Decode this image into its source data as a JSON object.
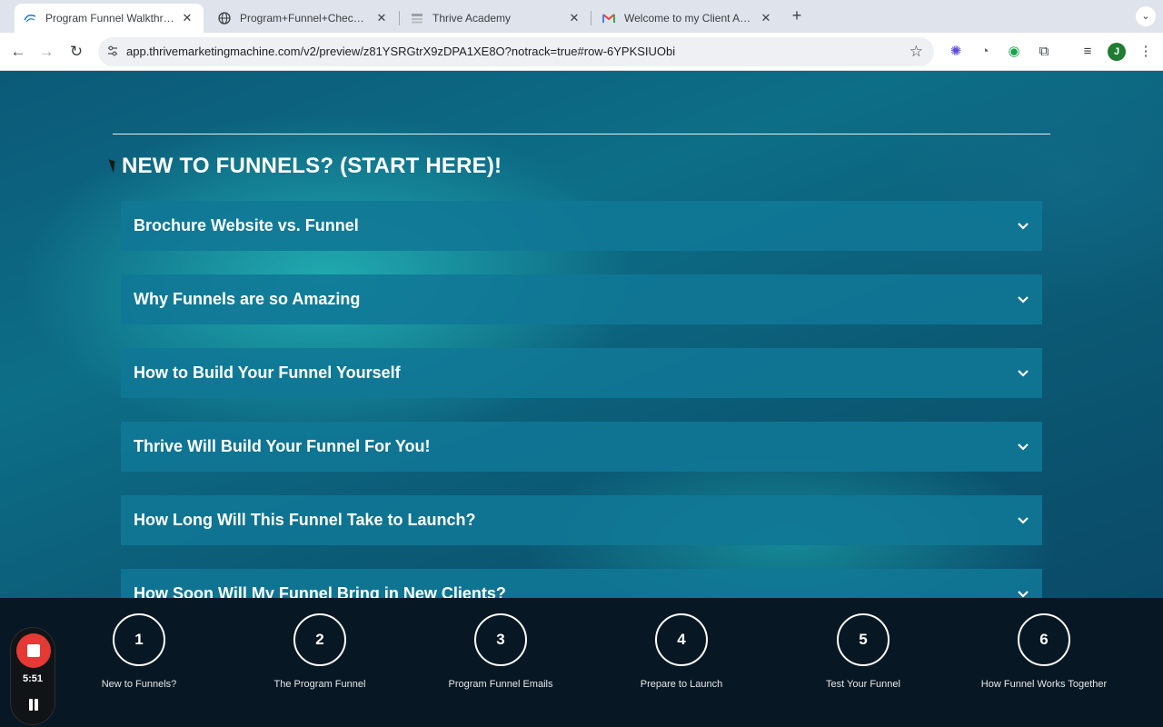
{
  "browser": {
    "tabs": [
      {
        "title": "Program Funnel Walkthrough",
        "active": true,
        "icon": "thrive-logo-icon"
      },
      {
        "title": "Program+Funnel+Checklist.p",
        "active": false,
        "icon": "globe-icon"
      },
      {
        "title": "Thrive Academy",
        "active": false,
        "icon": "thrive-academy-icon"
      },
      {
        "title": "Welcome to my Client Attracti",
        "active": false,
        "icon": "gmail-icon"
      }
    ],
    "url": "app.thrivemarketingmachine.com/v2/preview/z81YSRGtrX9zDPA1XE8O?notrack=true#row-6YPKSIUObi",
    "profile_initial": "J"
  },
  "page": {
    "section_title": "NEW TO FUNNELS? (START HERE)!",
    "accordion": [
      {
        "label": "Brochure Website vs. Funnel"
      },
      {
        "label": "Why Funnels are so Amazing"
      },
      {
        "label": "How to Build Your Funnel Yourself"
      },
      {
        "label": "Thrive Will Build Your Funnel For You!"
      },
      {
        "label": "How Long Will This Funnel Take to Launch?"
      },
      {
        "label": "How Soon Will My Funnel Bring in New Clients?"
      }
    ]
  },
  "steps": [
    {
      "number": "1",
      "label": "New to Funnels?"
    },
    {
      "number": "2",
      "label": "The Program Funnel"
    },
    {
      "number": "3",
      "label": "Program Funnel Emails"
    },
    {
      "number": "4",
      "label": "Prepare to Launch"
    },
    {
      "number": "5",
      "label": "Test Your Funnel"
    },
    {
      "number": "6",
      "label": "How Funnel Works Together"
    }
  ],
  "recorder": {
    "time": "5:51"
  },
  "colors": {
    "accent": "#1078a0",
    "stop": "#e53935"
  }
}
